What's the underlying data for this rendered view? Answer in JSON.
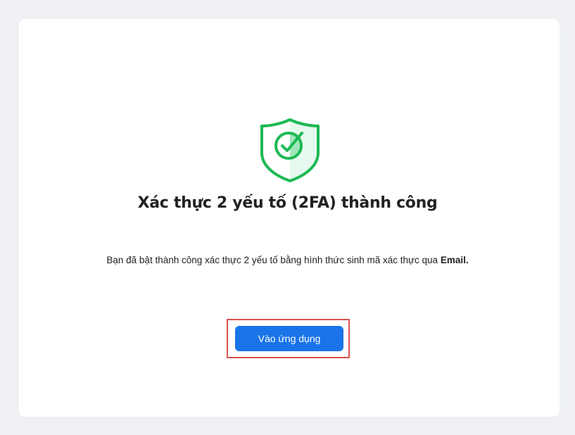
{
  "status": {
    "icon": "shield-check-icon",
    "color": "#1db954"
  },
  "title": "Xác thực 2 yếu tố (2FA) thành công",
  "description": {
    "text": "Bạn đã bật thành công xác thực 2 yếu tố bằng hình thức sinh mã xác thực qua ",
    "method": "Email."
  },
  "actions": {
    "enter_app_label": "Vào ứng dụng",
    "button_color": "#1a73e8",
    "highlight_color": "#d9534f"
  }
}
